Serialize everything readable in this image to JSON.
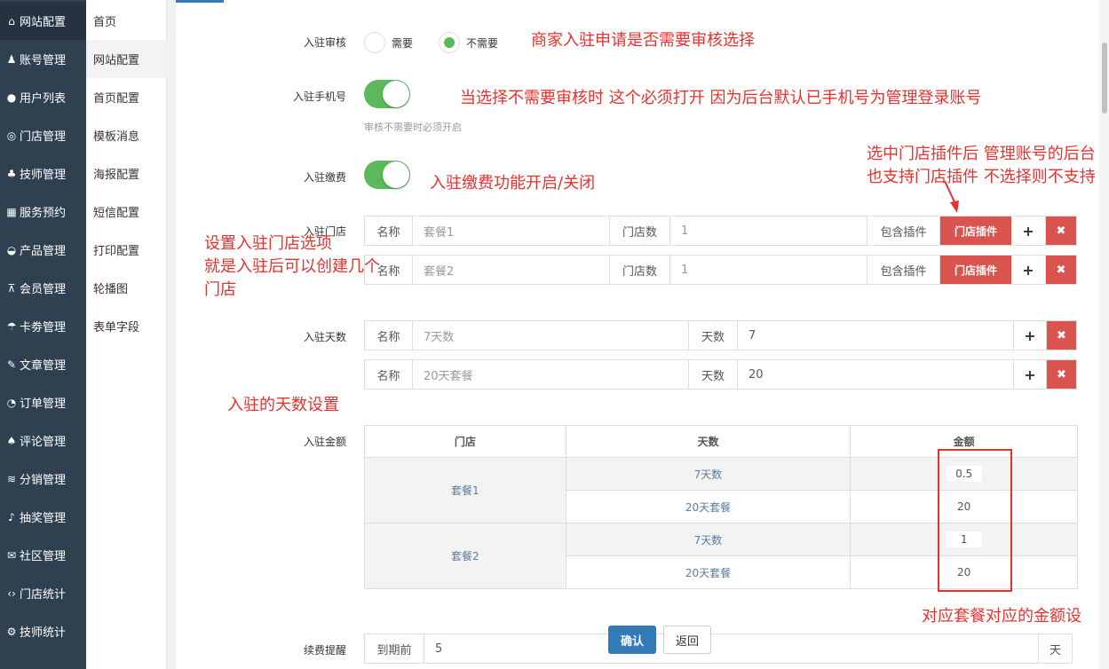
{
  "sidebar": {
    "items": [
      {
        "icon": "home-icon",
        "glyph": "⌂",
        "label": "网站配置",
        "active": true
      },
      {
        "icon": "users-icon",
        "glyph": "♟",
        "label": "账号管理"
      },
      {
        "icon": "user-icon",
        "glyph": "●",
        "label": "用户列表"
      },
      {
        "icon": "lifebuoy-icon",
        "glyph": "◎",
        "label": "门店管理"
      },
      {
        "icon": "person-icon",
        "glyph": "♣",
        "label": "技师管理"
      },
      {
        "icon": "calendar-icon",
        "glyph": "▦",
        "label": "服务预约"
      },
      {
        "icon": "product-icon",
        "glyph": "◒",
        "label": "产品管理"
      },
      {
        "icon": "sitemap-icon",
        "glyph": "⊼",
        "label": "会员管理"
      },
      {
        "icon": "umbrella-icon",
        "glyph": "☂",
        "label": "卡劵管理"
      },
      {
        "icon": "wrench-icon",
        "glyph": "✎",
        "label": "文章管理"
      },
      {
        "icon": "pie-chart-icon",
        "glyph": "◔",
        "label": "订单管理"
      },
      {
        "icon": "tree-icon",
        "glyph": "♠",
        "label": "评论管理"
      },
      {
        "icon": "wifi-icon",
        "glyph": "≋",
        "label": "分销管理"
      },
      {
        "icon": "bell-icon",
        "glyph": "♪",
        "label": "抽奖管理"
      },
      {
        "icon": "comments-icon",
        "glyph": "✉",
        "label": "社区管理"
      },
      {
        "icon": "code-icon",
        "glyph": "‹›",
        "label": "门店统计"
      },
      {
        "icon": "cogs-icon",
        "glyph": "⚙",
        "label": "技师统计"
      }
    ]
  },
  "subnav": {
    "items": [
      {
        "label": "首页"
      },
      {
        "label": "网站配置",
        "active": true
      },
      {
        "label": "首页配置"
      },
      {
        "label": "模板消息"
      },
      {
        "label": "海报配置"
      },
      {
        "label": "短信配置"
      },
      {
        "label": "打印配置"
      },
      {
        "label": "轮播图"
      },
      {
        "label": "表单字段"
      }
    ]
  },
  "form": {
    "audit": {
      "label": "入驻审核",
      "options": [
        "需要",
        "不需要"
      ],
      "selected": "不需要"
    },
    "phone": {
      "label": "入驻手机号",
      "enabled": true,
      "hint": "审核不需要时必须开启"
    },
    "fee": {
      "label": "入驻缴费",
      "enabled": true
    },
    "stores": {
      "label": "入驻门店",
      "rows": [
        {
          "name_label": "名称",
          "name_placeholder": "套餐1",
          "count_label": "门店数",
          "count_value": "1",
          "plugin_label": "包含插件",
          "plugin_button": "门店插件",
          "add": "+",
          "remove": "✖"
        },
        {
          "name_label": "名称",
          "name_placeholder": "套餐2",
          "count_label": "门店数",
          "count_value": "1",
          "plugin_label": "包含插件",
          "plugin_button": "门店插件",
          "add": "+",
          "remove": "✖"
        }
      ]
    },
    "days": {
      "label": "入驻天数",
      "rows": [
        {
          "name_label": "名称",
          "name_placeholder": "7天数",
          "days_label": "天数",
          "days_value": "7",
          "add": "+",
          "remove": "✖"
        },
        {
          "name_label": "名称",
          "name_placeholder": "20天套餐",
          "days_label": "天数",
          "days_value": "20",
          "add": "+",
          "remove": "✖"
        }
      ]
    },
    "amount": {
      "label": "入驻金额",
      "headers": [
        "门店",
        "天数",
        "金额"
      ],
      "groups": [
        {
          "store": "套餐1",
          "rows": [
            {
              "days": "7天数",
              "amount": "0.5"
            },
            {
              "days": "20天套餐",
              "amount": "20"
            }
          ]
        },
        {
          "store": "套餐2",
          "rows": [
            {
              "days": "7天数",
              "amount": "1"
            },
            {
              "days": "20天套餐",
              "amount": "20"
            }
          ]
        }
      ]
    },
    "renew": {
      "label": "续费提醒",
      "prefix": "到期前",
      "value": "5",
      "suffix": "天"
    },
    "confirm_button": "确认",
    "back_button": "返回"
  },
  "annotations": {
    "audit_note": "商家入驻申请是否需要审核选择",
    "phone_note": "当选择不需要审核时 这个必须打开 因为后台默认已手机号为管理登录账号",
    "fee_note": "入驻缴费功能开启/关闭",
    "plugin_note_1": "选中门店插件后 管理账号的后台",
    "plugin_note_2": "也支持门店插件 不选择则不支持",
    "store_note_1": "设置入驻门店选项",
    "store_note_2": "就是入驻后可以创建几个",
    "store_note_3": "门店",
    "days_note": "入驻的天数设置",
    "amount_note": "对应套餐对应的金额设"
  },
  "colors": {
    "sidebar_bg": "#2f4050",
    "accent_green": "#5cb85c",
    "danger": "#d9534f",
    "primary": "#337ab7",
    "annotation_red": "#e8302e"
  }
}
